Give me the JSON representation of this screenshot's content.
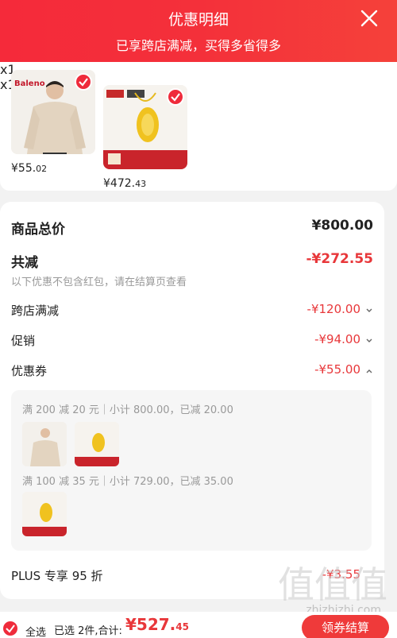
{
  "header": {
    "title": "优惠明细",
    "subtitle": "已享跨店满减，买得多省得多"
  },
  "products": [
    {
      "brand": "Baleno",
      "price_main": "¥55.",
      "price_dec": "02",
      "qty": "x1"
    },
    {
      "price_main": "¥472.",
      "price_dec": "43",
      "qty": "x1"
    }
  ],
  "summary": {
    "total_label": "商品总价",
    "total_value": "¥800.00",
    "discount_label": "共减",
    "discount_value": "-¥272.55",
    "note": "以下优惠不包含红包，请在结算页查看",
    "items": [
      {
        "label": "跨店满减",
        "value": "-¥120.00"
      },
      {
        "label": "促销",
        "value": "-¥94.00"
      },
      {
        "label": "优惠券",
        "value": "-¥55.00"
      }
    ],
    "coupons": [
      {
        "text": "满 200 减 20 元｜小计 800.00，已减 20.00"
      },
      {
        "text": "满 100 减 35 元｜小计 729.00，已减 35.00"
      }
    ],
    "plus_label": "PLUS 专享 95 折",
    "plus_value": "-¥3.55"
  },
  "bottom": {
    "select_all": "全选",
    "selected_text": "已选 2件,合计:",
    "total_main": "¥527.",
    "total_dec": "45",
    "checkout_label": "领券结算"
  },
  "watermark": {
    "mark": "值值值",
    "site": "zhizhizhi.com"
  },
  "colors": {
    "accent": "#ef2b3b",
    "header": "#f4303a"
  }
}
